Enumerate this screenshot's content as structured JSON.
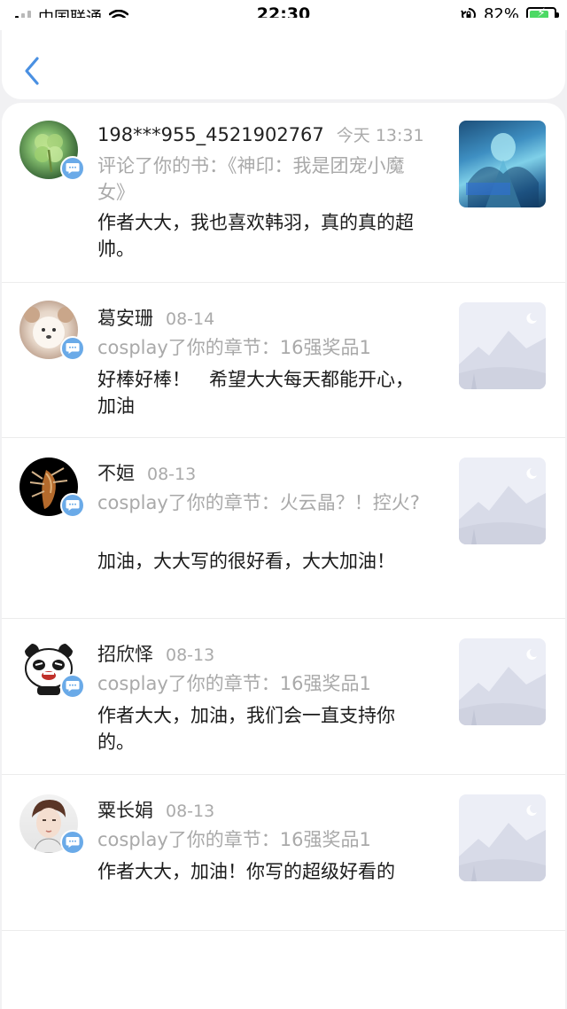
{
  "status_bar": {
    "carrier": "中国联通",
    "time": "22:30",
    "battery_percent": "82%",
    "battery_level": 0.82
  },
  "nav": {
    "back_icon": "chevron-left-icon",
    "accent_color": "#4a90e2"
  },
  "notifications": [
    {
      "name": "198***955_4521902767",
      "date": "今天 13:31",
      "action": "评论了你的书：《神印：我是团宠小魔女》",
      "comment": "作者大大，我也喜欢韩羽，真的真的超帅。",
      "thumb": "book-cover-image"
    },
    {
      "name": "葛安珊",
      "date": "08-14",
      "action": "cosplay了你的章节：16强奖品1",
      "comment": "好棒好棒！　希望大大每天都能开心，加油",
      "thumb": "placeholder-image"
    },
    {
      "name": "不姮",
      "date": "08-13",
      "action": "cosplay了你的章节：火云晶？！控火?",
      "comment": "加油，大大写的很好看，大大加油！",
      "thumb": "placeholder-image"
    },
    {
      "name": "招欣怿",
      "date": "08-13",
      "action": "cosplay了你的章节：16强奖品1",
      "comment": "作者大大，加油，我们会一直支持你的。",
      "thumb": "placeholder-image"
    },
    {
      "name": "粟长娟",
      "date": "08-13",
      "action": "cosplay了你的章节：16强奖品1",
      "comment": "作者大大，加油！你写的超级好看的",
      "thumb": "placeholder-image"
    }
  ]
}
